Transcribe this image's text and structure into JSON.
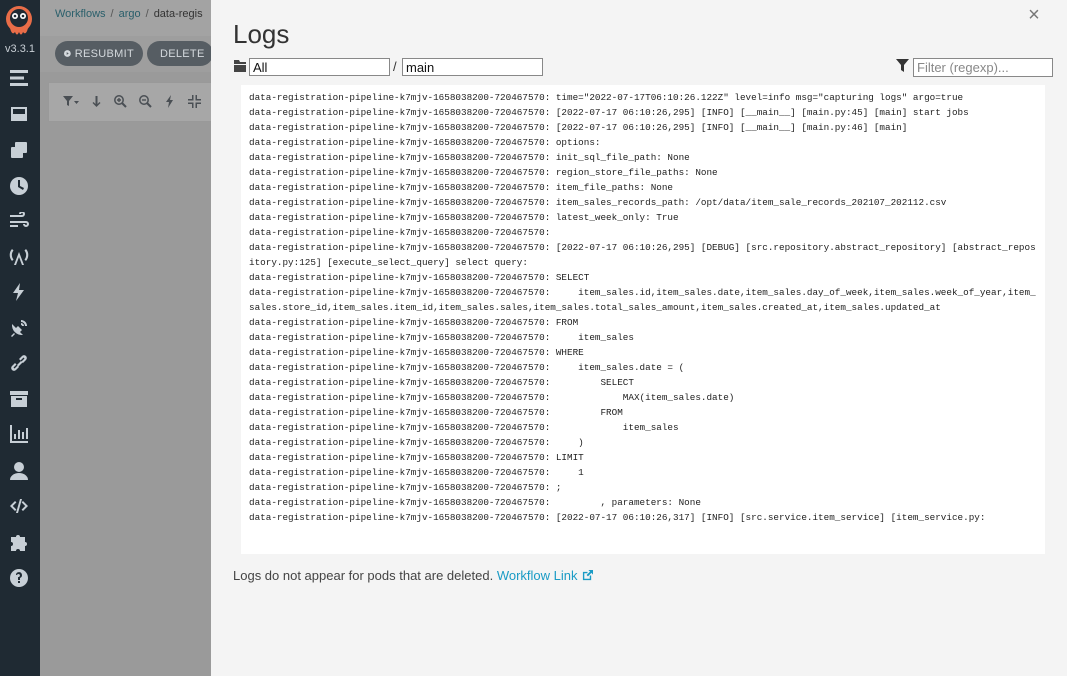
{
  "app": {
    "version": "v3.3.1"
  },
  "breadcrumb": {
    "items": [
      "Workflows",
      "argo",
      "data-regis"
    ]
  },
  "actions": {
    "resubmit": "RESUBMIT",
    "delete": "DELETE"
  },
  "drawer": {
    "title": "Logs",
    "pod_select_value": "All",
    "container_value": "main",
    "separator": "/",
    "filter_placeholder": "Filter (regexp)..."
  },
  "logs": [
    "data-registration-pipeline-k7mjv-1658038200-720467570: time=\"2022-07-17T06:10:26.122Z\" level=info msg=\"capturing logs\" argo=true",
    "data-registration-pipeline-k7mjv-1658038200-720467570: [2022-07-17 06:10:26,295] [INFO] [__main__] [main.py:45] [main] start jobs",
    "data-registration-pipeline-k7mjv-1658038200-720467570: [2022-07-17 06:10:26,295] [INFO] [__main__] [main.py:46] [main]",
    "data-registration-pipeline-k7mjv-1658038200-720467570: options:",
    "data-registration-pipeline-k7mjv-1658038200-720467570: init_sql_file_path: None",
    "data-registration-pipeline-k7mjv-1658038200-720467570: region_store_file_paths: None",
    "data-registration-pipeline-k7mjv-1658038200-720467570: item_file_paths: None",
    "data-registration-pipeline-k7mjv-1658038200-720467570: item_sales_records_path: /opt/data/item_sale_records_202107_202112.csv",
    "data-registration-pipeline-k7mjv-1658038200-720467570: latest_week_only: True",
    "data-registration-pipeline-k7mjv-1658038200-720467570:",
    "data-registration-pipeline-k7mjv-1658038200-720467570: [2022-07-17 06:10:26,295] [DEBUG] [src.repository.abstract_repository] [abstract_repository.py:125] [execute_select_query] select query:",
    "data-registration-pipeline-k7mjv-1658038200-720467570: SELECT",
    "data-registration-pipeline-k7mjv-1658038200-720467570:     item_sales.id,item_sales.date,item_sales.day_of_week,item_sales.week_of_year,item_sales.store_id,item_sales.item_id,item_sales.sales,item_sales.total_sales_amount,item_sales.created_at,item_sales.updated_at",
    "data-registration-pipeline-k7mjv-1658038200-720467570: FROM",
    "data-registration-pipeline-k7mjv-1658038200-720467570:     item_sales",
    "data-registration-pipeline-k7mjv-1658038200-720467570: WHERE",
    "data-registration-pipeline-k7mjv-1658038200-720467570:     item_sales.date = (",
    "data-registration-pipeline-k7mjv-1658038200-720467570:         SELECT",
    "data-registration-pipeline-k7mjv-1658038200-720467570:             MAX(item_sales.date)",
    "data-registration-pipeline-k7mjv-1658038200-720467570:         FROM",
    "data-registration-pipeline-k7mjv-1658038200-720467570:             item_sales",
    "data-registration-pipeline-k7mjv-1658038200-720467570:     )",
    "data-registration-pipeline-k7mjv-1658038200-720467570: LIMIT",
    "data-registration-pipeline-k7mjv-1658038200-720467570:     1",
    "data-registration-pipeline-k7mjv-1658038200-720467570: ;",
    "data-registration-pipeline-k7mjv-1658038200-720467570:         , parameters: None",
    "data-registration-pipeline-k7mjv-1658038200-720467570: [2022-07-17 06:10:26,317] [INFO] [src.service.item_service] [item_service.py:"
  ],
  "footer": {
    "text": "Logs do not appear for pods that are deleted.",
    "link_label": "Workflow Link"
  },
  "colors": {
    "nav_bg": "#1f2a33",
    "link": "#1a9bc5",
    "drawer_bg": "#f4f4f4"
  },
  "icons": {
    "nav": [
      "timeline-icon",
      "inbox-icon",
      "clone-icon",
      "clock-icon",
      "stream-icon",
      "broadcast-icon",
      "bolt-icon",
      "satellite-dish-icon",
      "link-icon",
      "archive-icon",
      "chart-icon",
      "user-icon",
      "code-icon",
      "puzzle-icon",
      "help-icon"
    ]
  }
}
